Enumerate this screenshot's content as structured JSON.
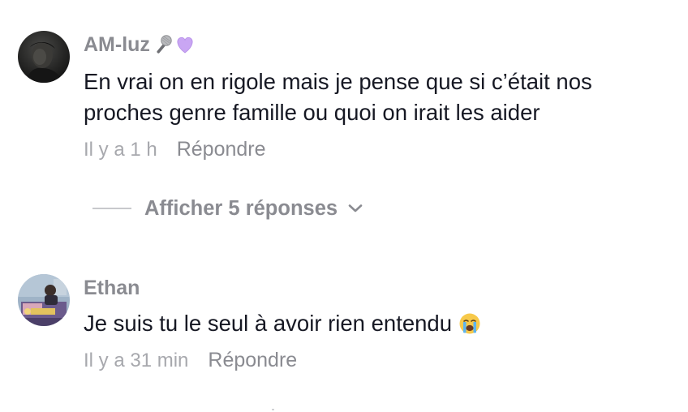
{
  "comments": [
    {
      "username": "AM-luz",
      "name_emojis": [
        "microphone-emoji",
        "purple-heart-emoji"
      ],
      "text": "En vrai on en rigole mais je pense que si c’était nos proches genre famille ou quoi on irait les aider",
      "time": "Il y a 1 h",
      "reply_label": "Répondre"
    },
    {
      "username": "Ethan",
      "text": "Je suis tu le seul à avoir rien entendu",
      "text_emoji": "loudly-crying-face-emoji",
      "time": "Il y a 31 min",
      "reply_label": "Répondre"
    }
  ],
  "view_replies": {
    "label": "Afficher 5 réponses",
    "icon": "chevron-down-icon"
  },
  "colors": {
    "primary_text": "#161823",
    "username": "#8a8b91",
    "timestamp": "#a7a8ad",
    "divider": "#c8c9cc"
  }
}
